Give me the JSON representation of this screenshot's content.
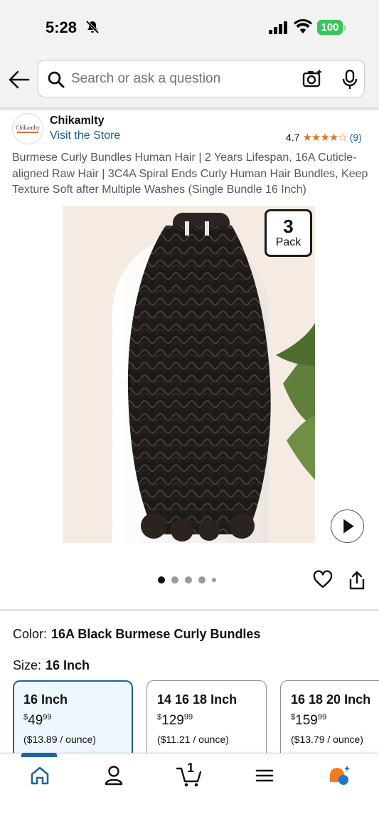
{
  "status_bar": {
    "time": "5:28",
    "battery": "100"
  },
  "search": {
    "placeholder": "Search or ask a question"
  },
  "store": {
    "logo_text": "Chikamlty",
    "name": "Chikamlty",
    "visit_label": "Visit the Store"
  },
  "rating": {
    "value": "4.7",
    "stars": "★★★★☆",
    "count": "(9)",
    "star_value": 4.5
  },
  "product": {
    "title": "Burmese Curly Bundles Human Hair | 2 Years Lifespan, 16A Cuticle-aligned Raw Hair | 3C4A Spiral Ends Curly Human Hair Bundles, Keep Texture Soft after Multiple Washes (Single Bundle 16 Inch)",
    "badge_number": "3",
    "badge_label": "Pack",
    "image_count": 5,
    "active_image": 1
  },
  "color": {
    "label": "Color:",
    "value": "16A Black Burmese Curly Bundles"
  },
  "size": {
    "label": "Size:",
    "value": "16 Inch"
  },
  "size_options": [
    {
      "name": "16 Inch",
      "currency": "$",
      "dollars": "49",
      "cents": "99",
      "unit": "($13.89 / ounce)",
      "selected": true
    },
    {
      "name": "14 16 18 Inch",
      "currency": "$",
      "dollars": "129",
      "cents": "99",
      "unit": "($11.21 / ounce)",
      "selected": false
    },
    {
      "name": "16 18 20 Inch",
      "currency": "$",
      "dollars": "159",
      "cents": "99",
      "unit": "($13.79 / ounce)",
      "selected": false
    }
  ],
  "nav": {
    "cart_count": "1",
    "items": [
      "home-icon",
      "account-icon",
      "cart-icon",
      "menu-icon",
      "rufus-icon"
    ]
  },
  "colors": {
    "accent": "#2162a1",
    "link": "#1a5e8f",
    "star": "#e7711b",
    "battery": "#34c759"
  }
}
